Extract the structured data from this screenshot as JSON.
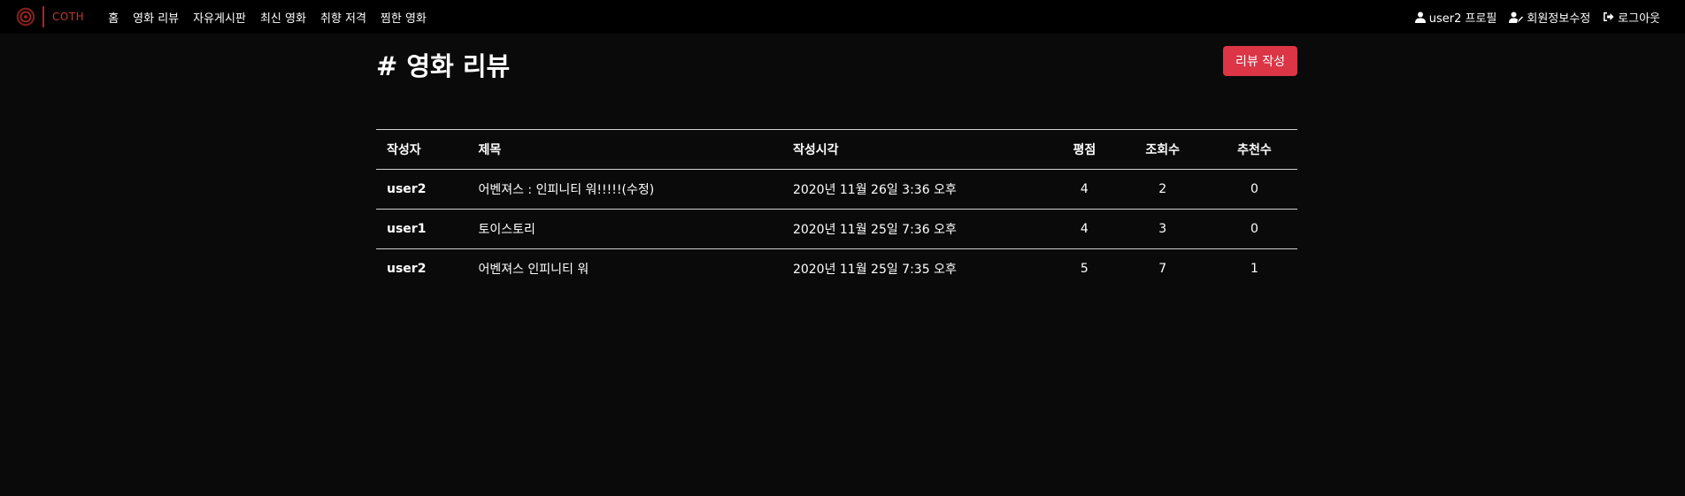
{
  "brand": {
    "name": "COTH",
    "logo_icon": "film-reel-icon",
    "accent": "#c0392b"
  },
  "nav": {
    "links": [
      "홈",
      "영화 리뷰",
      "자유게시판",
      "최신 영화",
      "취향 저격",
      "찜한 영화"
    ],
    "right": [
      {
        "label": "user2 프로필",
        "icon": "user-icon"
      },
      {
        "label": "회원정보수정",
        "icon": "user-edit-icon"
      },
      {
        "label": "로그아웃",
        "icon": "sign-out-icon"
      }
    ]
  },
  "page": {
    "title": "# 영화 리뷰",
    "write_button": "리뷰 작성",
    "button_color": "#dc3545"
  },
  "table": {
    "headers": [
      "작성자",
      "제목",
      "작성시각",
      "평점",
      "조회수",
      "추천수"
    ],
    "rows": [
      [
        "user2",
        "어벤져스 : 인피니티 워!!!!!(수정)",
        "2020년 11월 26일 3:36 오후",
        "4",
        "2",
        "0"
      ],
      [
        "user1",
        "토이스토리",
        "2020년 11월 25일 7:36 오후",
        "4",
        "3",
        "0"
      ],
      [
        "user2",
        "어벤져스 인피니티 워",
        "2020년 11월 25일 7:35 오후",
        "5",
        "7",
        "1"
      ]
    ]
  }
}
